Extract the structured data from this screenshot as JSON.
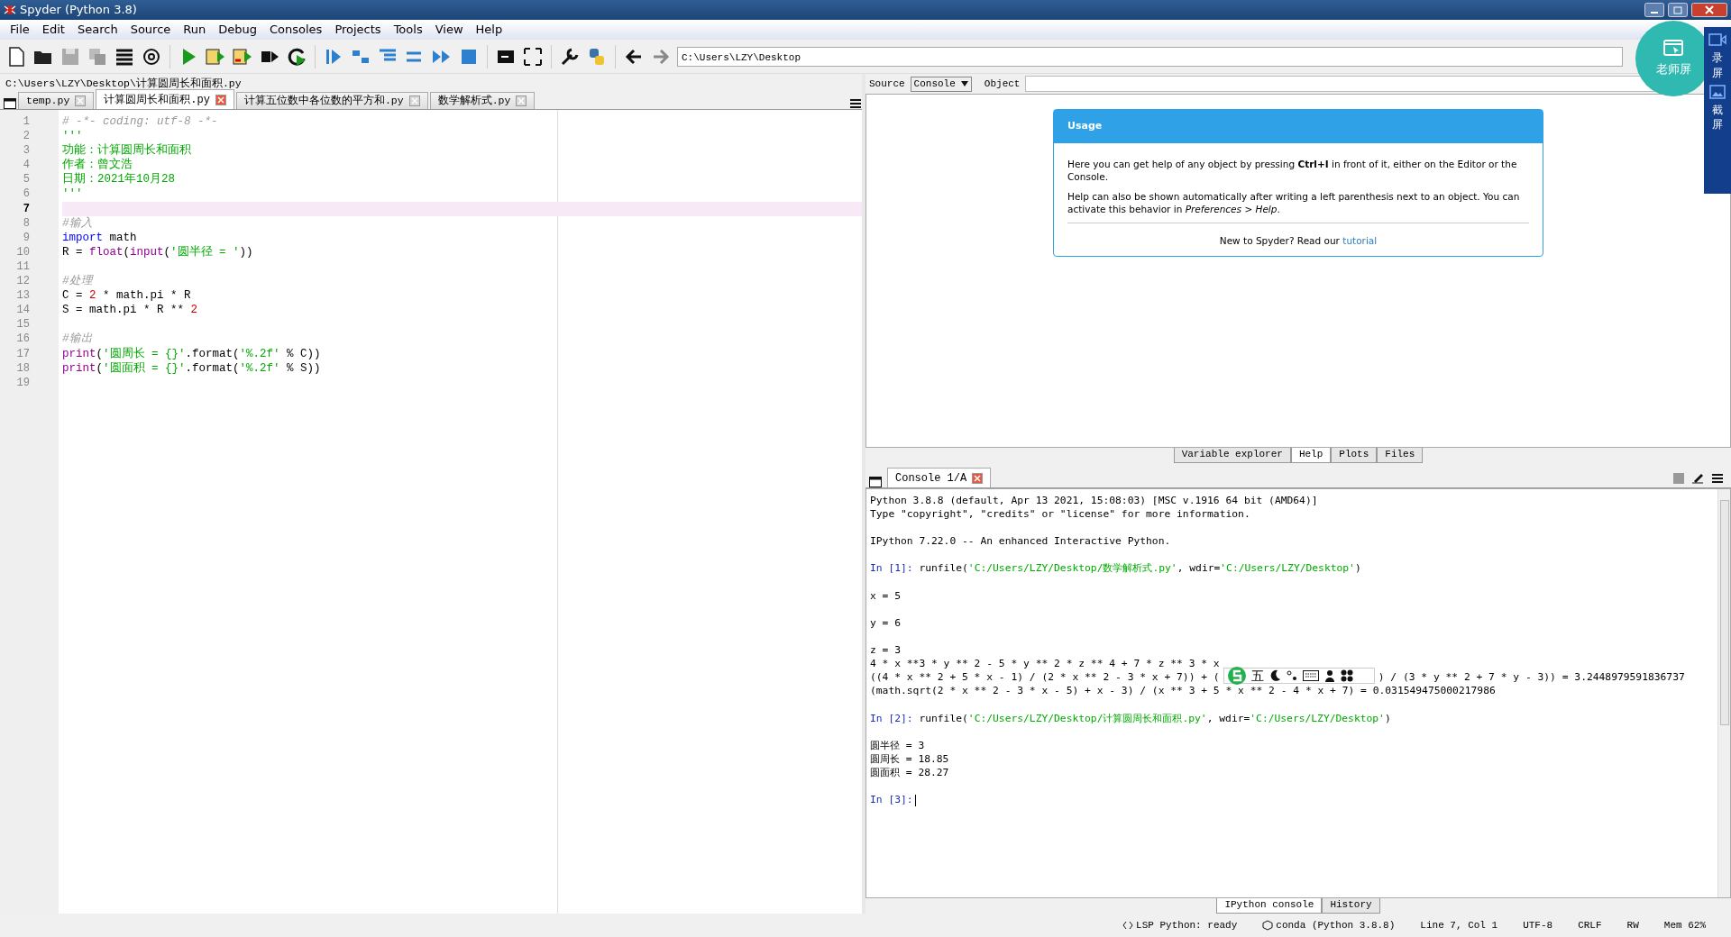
{
  "window": {
    "title": "Spyder (Python 3.8)"
  },
  "menu": [
    "File",
    "Edit",
    "Search",
    "Source",
    "Run",
    "Debug",
    "Consoles",
    "Projects",
    "Tools",
    "View",
    "Help"
  ],
  "toolbar": {
    "path": "C:\\Users\\LZY\\Desktop"
  },
  "editor": {
    "file_path": "C:\\Users\\LZY\\Desktop\\计算圆周长和面积.py",
    "tabs": [
      {
        "label": "temp.py",
        "selected": false
      },
      {
        "label": "计算圆周长和面积.py",
        "selected": true
      },
      {
        "label": "计算五位数中各位数的平方和.py",
        "selected": false
      },
      {
        "label": "数学解析式.py",
        "selected": false
      }
    ],
    "lines": [
      {
        "number": "1",
        "current": false,
        "tokens": [
          {
            "kind": "comment",
            "text": "# -*- coding: utf-8 -*-"
          }
        ]
      },
      {
        "number": "2",
        "current": false,
        "tokens": [
          {
            "kind": "string",
            "text": "'''"
          }
        ]
      },
      {
        "number": "3",
        "current": false,
        "tokens": [
          {
            "kind": "string",
            "text": "功能：计算圆周长和面积"
          }
        ]
      },
      {
        "number": "4",
        "current": false,
        "tokens": [
          {
            "kind": "string",
            "text": "作者：曾文浩"
          }
        ]
      },
      {
        "number": "5",
        "current": false,
        "tokens": [
          {
            "kind": "string",
            "text": "日期：2021年10月28"
          }
        ]
      },
      {
        "number": "6",
        "current": false,
        "tokens": [
          {
            "kind": "string",
            "text": "'''"
          }
        ]
      },
      {
        "number": "7",
        "current": true
      },
      {
        "number": "8",
        "current": false,
        "tokens": [
          {
            "kind": "comment",
            "text": "#输入"
          }
        ]
      },
      {
        "number": "9",
        "current": false,
        "tokens": [
          {
            "kind": "keyword",
            "text": "import"
          },
          {
            "kind": "plain",
            "text": " math"
          }
        ]
      },
      {
        "number": "10",
        "current": false,
        "tokens": [
          {
            "kind": "plain",
            "text": "R = "
          },
          {
            "kind": "builtin",
            "text": "float"
          },
          {
            "kind": "plain",
            "text": "("
          },
          {
            "kind": "builtin",
            "text": "input"
          },
          {
            "kind": "plain",
            "text": "("
          },
          {
            "kind": "string",
            "text": "'圆半径 = '"
          },
          {
            "kind": "plain",
            "text": "))"
          }
        ]
      },
      {
        "number": "11",
        "current": false
      },
      {
        "number": "12",
        "current": false,
        "tokens": [
          {
            "kind": "comment",
            "text": "#处理"
          }
        ]
      },
      {
        "number": "13",
        "current": false,
        "tokens": [
          {
            "kind": "plain",
            "text": "C = "
          },
          {
            "kind": "number",
            "text": "2"
          },
          {
            "kind": "plain",
            "text": " * math.pi * R"
          }
        ]
      },
      {
        "number": "14",
        "current": false,
        "tokens": [
          {
            "kind": "plain",
            "text": "S = math.pi * R ** "
          },
          {
            "kind": "number",
            "text": "2"
          }
        ]
      },
      {
        "number": "15",
        "current": false
      },
      {
        "number": "16",
        "current": false,
        "tokens": [
          {
            "kind": "comment",
            "text": "#输出"
          }
        ]
      },
      {
        "number": "17",
        "current": false,
        "tokens": [
          {
            "kind": "builtin",
            "text": "print"
          },
          {
            "kind": "plain",
            "text": "("
          },
          {
            "kind": "string",
            "text": "'圆周长 = {}'"
          },
          {
            "kind": "plain",
            "text": ".format("
          },
          {
            "kind": "string",
            "text": "'%.2f'"
          },
          {
            "kind": "plain",
            "text": " % C))"
          }
        ]
      },
      {
        "number": "18",
        "current": false,
        "tokens": [
          {
            "kind": "builtin",
            "text": "print"
          },
          {
            "kind": "plain",
            "text": "("
          },
          {
            "kind": "string",
            "text": "'圆面积 = {}'"
          },
          {
            "kind": "plain",
            "text": ".format("
          },
          {
            "kind": "string",
            "text": "'%.2f'"
          },
          {
            "kind": "plain",
            "text": " % S))"
          }
        ]
      },
      {
        "number": "19",
        "current": false
      }
    ]
  },
  "help": {
    "source_label": "Source",
    "source_value": "Console",
    "object_label": "Object",
    "card": {
      "title": "Usage",
      "para1": "Here you can get help of any object by pressing **Ctrl+I** in front of it, either on the Editor or the Console.",
      "para2": "Help can also be shown automatically after writing a left parenthesis next to an object. You can activate this behavior in *Preferences > Help*.",
      "footer_text": "New to Spyder? Read our",
      "footer_link": "tutorial"
    },
    "tabs": [
      {
        "label": "Variable explorer",
        "selected": false
      },
      {
        "label": "Help",
        "selected": true
      },
      {
        "label": "Plots",
        "selected": false
      },
      {
        "label": "Files",
        "selected": false
      }
    ]
  },
  "console": {
    "tabs": [
      {
        "label": "Console 1/A",
        "selected": true
      }
    ],
    "lines": [
      {
        "gap_before": false,
        "segments": [
          {
            "kind": "plain",
            "text": "Python 3.8.8 (default, Apr 13 2021, 15:08:03) [MSC v.1916 64 bit (AMD64)]"
          }
        ]
      },
      {
        "gap_before": false,
        "segments": [
          {
            "kind": "plain",
            "text": "Type \"copyright\", \"credits\" or \"license\" for more information."
          }
        ]
      },
      {
        "gap_before": true,
        "segments": [
          {
            "kind": "plain",
            "text": "IPython 7.22.0 -- An enhanced Interactive Python."
          }
        ]
      },
      {
        "gap_before": true,
        "segments": [
          {
            "kind": "prompt",
            "text": "In [1]:"
          },
          {
            "kind": "plain",
            "text": " runfile("
          },
          {
            "kind": "string",
            "text": "'C:/Users/LZY/Desktop/数学解析式.py'"
          },
          {
            "kind": "plain",
            "text": ", wdir="
          },
          {
            "kind": "string",
            "text": "'C:/Users/LZY/Desktop'"
          },
          {
            "kind": "plain",
            "text": ")"
          }
        ]
      },
      {
        "gap_before": true,
        "segments": [
          {
            "kind": "plain",
            "text": "x = 5"
          }
        ]
      },
      {
        "gap_before": true,
        "segments": [
          {
            "kind": "plain",
            "text": "y = 6"
          }
        ]
      },
      {
        "gap_before": true,
        "segments": [
          {
            "kind": "plain",
            "text": "z = 3"
          }
        ]
      },
      {
        "gap_before": false,
        "segments": [
          {
            "kind": "plain",
            "text": "4 * x **3 * y ** 2 - 5 * y ** 2 * z ** 4 + 7 * z ** 3 * x"
          }
        ]
      },
      {
        "gap_before": false,
        "segments": [
          {
            "kind": "plain",
            "text": "((4 * x ** 2 + 5 * x - 1) / (2 * x ** 2 - 3 * x + 7)) + ("
          },
          {
            "kind": "ime_gap"
          },
          {
            "kind": "plain",
            "text": ") / (3 * y ** 2 + 7 * y - 3)) = 3.2448979591836737"
          }
        ]
      },
      {
        "gap_before": false,
        "segments": [
          {
            "kind": "plain",
            "text": "(math.sqrt(2 * x ** 2 - 3 * x - 5) + x - 3) / (x ** 3 + 5 * x ** 2 - 4 * x + 7) = 0.031549475000217986"
          }
        ]
      },
      {
        "gap_before": true,
        "segments": [
          {
            "kind": "prompt",
            "text": "In [2]:"
          },
          {
            "kind": "plain",
            "text": " runfile("
          },
          {
            "kind": "string",
            "text": "'C:/Users/LZY/Desktop/计算圆周长和面积.py'"
          },
          {
            "kind": "plain",
            "text": ", wdir="
          },
          {
            "kind": "string",
            "text": "'C:/Users/LZY/Desktop'"
          },
          {
            "kind": "plain",
            "text": ")"
          }
        ]
      },
      {
        "gap_before": true,
        "segments": [
          {
            "kind": "plain",
            "text": "圆半径 = 3"
          }
        ]
      },
      {
        "gap_before": false,
        "segments": [
          {
            "kind": "plain",
            "text": "圆周长 = 18.85"
          }
        ]
      },
      {
        "gap_before": false,
        "segments": [
          {
            "kind": "plain",
            "text": "圆面积 = 28.27"
          }
        ]
      },
      {
        "gap_before": true,
        "segments": [
          {
            "kind": "prompt",
            "text": "In [3]:"
          },
          {
            "kind": "cursor"
          }
        ]
      }
    ],
    "bottom_tabs": [
      {
        "label": "IPython console",
        "selected": true
      },
      {
        "label": "History",
        "selected": false
      }
    ]
  },
  "ime_bar": {
    "mode": "五"
  },
  "overlay": {
    "teacher_button": "老师屏",
    "record_label": "录屏",
    "capture_label": "截屏"
  },
  "status_bar": [
    {
      "kind": "lsp",
      "text": "LSP Python: ready"
    },
    {
      "kind": "conda",
      "text": "conda (Python 3.8.8)"
    },
    {
      "kind": "plain",
      "text": "Line 7, Col 1"
    },
    {
      "kind": "plain",
      "text": "UTF-8"
    },
    {
      "kind": "plain",
      "text": "CRLF"
    },
    {
      "kind": "plain",
      "text": "RW"
    },
    {
      "kind": "plain",
      "text": "Mem 62%"
    }
  ]
}
